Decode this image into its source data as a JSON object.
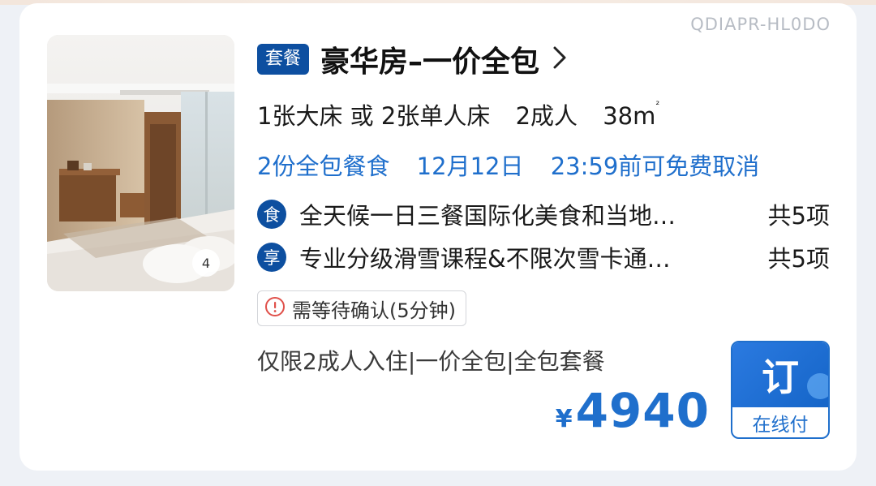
{
  "watermark": "QDIAPR-HL0DO",
  "room": {
    "badge": "套餐",
    "title": "豪华房–一价全包",
    "photo_count": "4",
    "beds": "1张大床 或 2张单人床",
    "guests": "2成人",
    "area": "38m",
    "area_unit_sup": "²",
    "meals": "2份全包餐食",
    "cancel_date": "12月12日",
    "cancel_text": "23:59前可免费取消"
  },
  "perks": [
    {
      "icon": "食",
      "text": "全天候一日三餐国际化美食和当地…",
      "count": "共5项"
    },
    {
      "icon": "享",
      "text": "专业分级滑雪课程&不限次雪卡通…",
      "count": "共5项"
    }
  ],
  "confirm": {
    "text": "需等待确认(5分钟)"
  },
  "limits": "仅限2成人入住|一价全包|全包套餐",
  "price": {
    "currency": "¥",
    "amount": "4940"
  },
  "book": {
    "label": "订",
    "sublabel": "在线付"
  },
  "colors": {
    "brand": "#0d4fa0",
    "accent": "#1f6fcc",
    "alert": "#e0504a"
  }
}
